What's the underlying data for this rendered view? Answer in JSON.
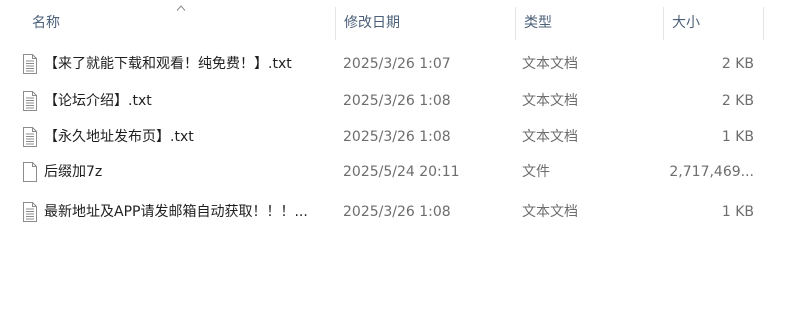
{
  "columns": {
    "name": "名称",
    "date_modified": "修改日期",
    "type": "类型",
    "size": "大小"
  },
  "files": [
    {
      "name": "【来了就能下载和观看！纯免费！】.txt",
      "date": "2025/3/26 1:07",
      "type": "文本文档",
      "size": "2 KB",
      "icon": "text-file-icon",
      "selected": false
    },
    {
      "name": "【论坛介绍】.txt",
      "date": "2025/3/26 1:08",
      "type": "文本文档",
      "size": "2 KB",
      "icon": "text-file-icon",
      "selected": false
    },
    {
      "name": "【永久地址发布页】.txt",
      "date": "2025/3/26 1:08",
      "type": "文本文档",
      "size": "1 KB",
      "icon": "text-file-icon",
      "selected": false
    },
    {
      "name": "后缀加7z",
      "date": "2025/5/24 20:11",
      "type": "文件",
      "size": "2,717,469...",
      "icon": "blank-file-icon",
      "selected": true
    },
    {
      "name": "最新地址及APP请发邮箱自动获取！！！...",
      "date": "2025/3/26 1:08",
      "type": "文本文档",
      "size": "1 KB",
      "icon": "text-file-icon",
      "selected": false
    }
  ]
}
